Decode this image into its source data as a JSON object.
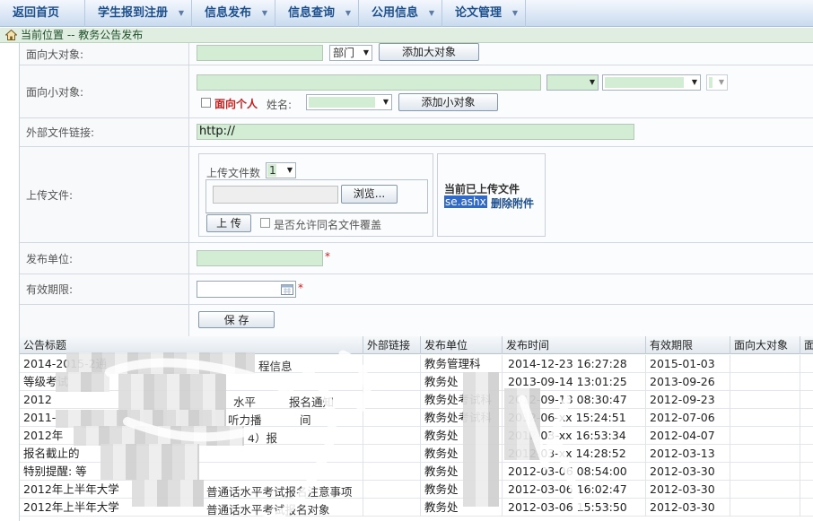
{
  "nav": {
    "items": [
      {
        "label": "返回首页",
        "caret": false
      },
      {
        "label": "学生报到注册",
        "caret": true
      },
      {
        "label": "信息发布",
        "caret": true
      },
      {
        "label": "信息查询",
        "caret": true
      },
      {
        "label": "公用信息",
        "caret": true
      },
      {
        "label": "论文管理",
        "caret": true
      }
    ]
  },
  "breadcrumb": {
    "text": "当前位置 -- 教务公告发布"
  },
  "form": {
    "big_target": {
      "label": "面向大对象:",
      "select_value": "部门",
      "add_button": "添加大对象"
    },
    "small_target": {
      "label": "面向小对象:",
      "personal_label": "面向个人",
      "name_label": "姓名:",
      "add_button": "添加小对象"
    },
    "external_link": {
      "label": "外部文件链接:",
      "value": "http://"
    },
    "upload": {
      "label": "上传文件:",
      "count_label": "上传文件数",
      "count_value": "1",
      "browse_button": "浏览...",
      "upload_button": "上 传",
      "overwrite_label": "是否允许同名文件覆盖",
      "current_title": "当前已上传文件",
      "current_file": "se.ashx",
      "delete_link": "删除附件"
    },
    "publisher": {
      "label": "发布单位:",
      "required_mark": "*"
    },
    "expiry": {
      "label": "有效期限:",
      "required_mark": "*"
    },
    "save_button": "保 存"
  },
  "table": {
    "headers": [
      "公告标题",
      "外部链接",
      "发布单位",
      "发布时间",
      "有效期限",
      "面向大对象",
      "面"
    ],
    "rows": [
      [
        "2014-2015-2通",
        "",
        "教务管理科",
        "2014-12-23 16:27:28",
        "2015-01-03"
      ],
      [
        "等级考试",
        "",
        "教务处",
        "2013-09-14 13:01:25",
        "2013-09-26"
      ],
      [
        "2012",
        "",
        "教务处考试科",
        "2012-09-13 08:30:47",
        "2012-09-23"
      ],
      [
        "2011-",
        "",
        "教务处考试科",
        "2012-06-xx 15:24:51",
        "2012-07-06"
      ],
      [
        "2012年",
        "",
        "教务处",
        "2012-03-xx 16:53:34",
        "2012-04-07"
      ],
      [
        "报名截止的",
        "",
        "教务处",
        "2012-03-xx 14:28:52",
        "2012-03-13"
      ],
      [
        "特别提醒: 等",
        "",
        "教务处",
        "2012-03-06 08:54:00",
        "2012-03-30"
      ],
      [
        "2012年上半年大学",
        "",
        "教务处",
        "2012-03-06 16:02:47",
        "2012-03-30"
      ],
      [
        "2012年上半年大学",
        "",
        "教务处",
        "2012-03-06 15:53:50",
        "2012-03-30"
      ]
    ],
    "row_fragments": {
      "r0_mid": "程信息",
      "r2_mid": "水平",
      "r2_mid2": "报名通知",
      "r3_mid": "听力播",
      "r3_mid2": "间",
      "r4_mid": "4）报",
      "r7_mid": "普通话水平考试报名注意事项",
      "r8_mid": "普通话水平考试报名对象"
    }
  }
}
